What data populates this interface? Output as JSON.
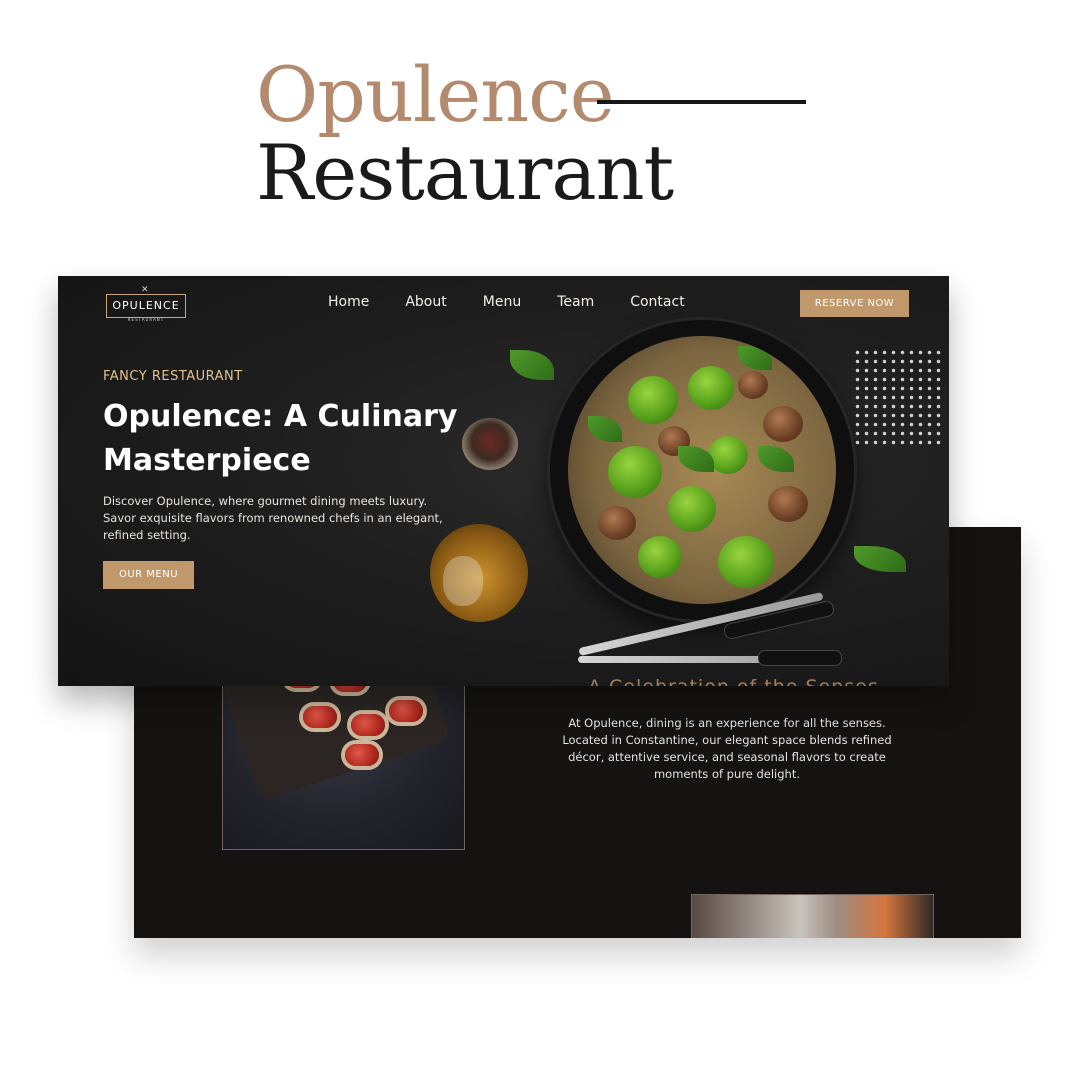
{
  "title": {
    "line1": "Opulence",
    "line2": "Restaurant"
  },
  "hero": {
    "logo_text": "OPULENCE",
    "logo_sub": "RESTAURANT",
    "nav": [
      "Home",
      "About",
      "Menu",
      "Team",
      "Contact"
    ],
    "reserve_label": "RESERVE NOW",
    "eyebrow": "FANCY RESTAURANT",
    "headline": "Opulence: A Culinary Masterpiece",
    "description": "Discover Opulence, where gourmet dining meets luxury. Savor exquisite flavors from renowned chefs in an elegant, refined setting.",
    "menu_button": "OUR MENU"
  },
  "section": {
    "heading": "A Celebration of the Senses",
    "paragraph": "At Opulence, dining is an experience for all the senses. Located in Constantine, our elegant space blends refined décor, attentive service, and seasonal flavors to create moments of pure delight."
  },
  "colors": {
    "brand_gold": "#c0986c",
    "title_bronze": "#b48a6e",
    "dark_bg": "#141312"
  }
}
